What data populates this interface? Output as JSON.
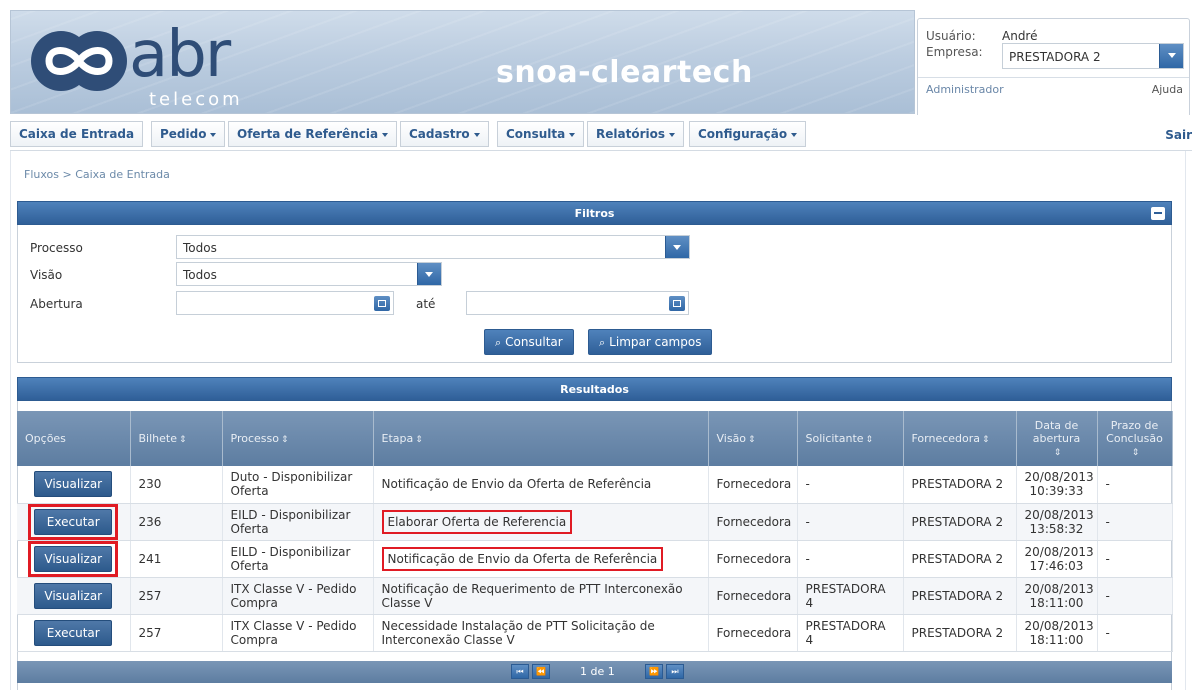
{
  "header": {
    "logo_text": "abr",
    "logo_sub": "telecom",
    "app_title": "snoa-cleartech"
  },
  "user": {
    "user_label": "Usuário:",
    "user_value": "André",
    "company_label": "Empresa:",
    "company_value": "PRESTADORA 2",
    "role": "Administrador",
    "help": "Ajuda"
  },
  "menu": {
    "items": [
      {
        "label": "Caixa de Entrada"
      },
      {
        "label": "Pedido"
      },
      {
        "label": "Oferta de Referência"
      },
      {
        "label": "Cadastro"
      },
      {
        "label": "Consulta"
      },
      {
        "label": "Relatórios"
      },
      {
        "label": "Configuração"
      }
    ],
    "logout": "Sair"
  },
  "breadcrumb": "Fluxos > Caixa de Entrada",
  "filters": {
    "title": "Filtros",
    "process_label": "Processo",
    "process_value": "Todos",
    "view_label": "Visão",
    "view_value": "Todos",
    "opening_label": "Abertura",
    "opening_from": "",
    "until_label": "até",
    "opening_to": "",
    "search_button": "Consultar",
    "clear_button": "Limpar campos"
  },
  "results": {
    "title": "Resultados",
    "columns": [
      "Opções",
      "Bilhete",
      "Processo",
      "Etapa",
      "Visão",
      "Solicitante",
      "Fornecedora",
      "Data de abertura",
      "Prazo de Conclusão"
    ],
    "rows": [
      {
        "action": "Visualizar",
        "ticket": "230",
        "process": "Duto - Disponibilizar Oferta",
        "step": "Notificação de Envio da Oferta de Referência",
        "view": "Fornecedora",
        "requester": "-",
        "supplier": "PRESTADORA 2",
        "opened": "20/08/2013 10:39:33",
        "deadline": "-"
      },
      {
        "action": "Executar",
        "ticket": "236",
        "process": "EILD - Disponibilizar Oferta",
        "step": "Elaborar Oferta de Referencia",
        "view": "Fornecedora",
        "requester": "-",
        "supplier": "PRESTADORA 2",
        "opened": "20/08/2013 13:58:32",
        "deadline": "-"
      },
      {
        "action": "Visualizar",
        "ticket": "241",
        "process": "EILD - Disponibilizar Oferta",
        "step": "Notificação de Envio da Oferta de Referência",
        "view": "Fornecedora",
        "requester": "-",
        "supplier": "PRESTADORA 2",
        "opened": "20/08/2013 17:46:03",
        "deadline": "-"
      },
      {
        "action": "Visualizar",
        "ticket": "257",
        "process": "ITX Classe V - Pedido Compra",
        "step": "Notificação de Requerimento de PTT Interconexão Classe V",
        "view": "Fornecedora",
        "requester": "PRESTADORA 4",
        "supplier": "PRESTADORA 2",
        "opened": "20/08/2013 18:11:00",
        "deadline": "-"
      },
      {
        "action": "Executar",
        "ticket": "257",
        "process": "ITX Classe V - Pedido Compra",
        "step": "Necessidade Instalação de PTT Solicitação de Interconexão Classe V",
        "view": "Fornecedora",
        "requester": "PRESTADORA 4",
        "supplier": "PRESTADORA 2",
        "opened": "20/08/2013 18:11:00",
        "deadline": "-"
      }
    ],
    "pager": {
      "text": "1 de 1"
    }
  }
}
